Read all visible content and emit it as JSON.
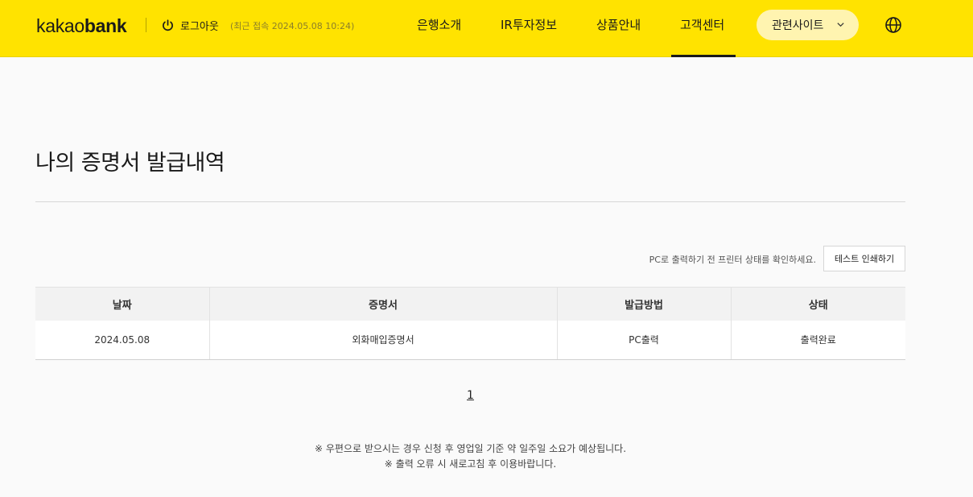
{
  "header": {
    "logo_part1": "kakao",
    "logo_part2": "bank",
    "logout_label": "로그아웃",
    "last_login": "(최근 접속 2024.05.08 10:24)",
    "nav": [
      {
        "label": "은행소개",
        "active": false
      },
      {
        "label": "IR투자정보",
        "active": false
      },
      {
        "label": "상품안내",
        "active": false
      },
      {
        "label": "고객센터",
        "active": true
      }
    ],
    "related_sites_label": "관련사이트",
    "brand_color": "#ffe300"
  },
  "main": {
    "title": "나의 증명서 발급내역",
    "print_notice": "PC로 출력하기 전 프린터 상태를 확인하세요.",
    "test_print_label": "테스트 인쇄하기",
    "table": {
      "headers": [
        "날짜",
        "증명서",
        "발급방법",
        "상태"
      ],
      "rows": [
        [
          "2024.05.08",
          "외화매입증명서",
          "PC출력",
          "출력완료"
        ]
      ]
    },
    "pagination": {
      "current": "1"
    },
    "footnotes": [
      "※ 우편으로 받으시는 경우 신청 후 영업일 기준 약 일주일 소요가 예상됩니다.",
      "※ 출력 오류 시 새로고침 후 이용바랍니다."
    ]
  }
}
